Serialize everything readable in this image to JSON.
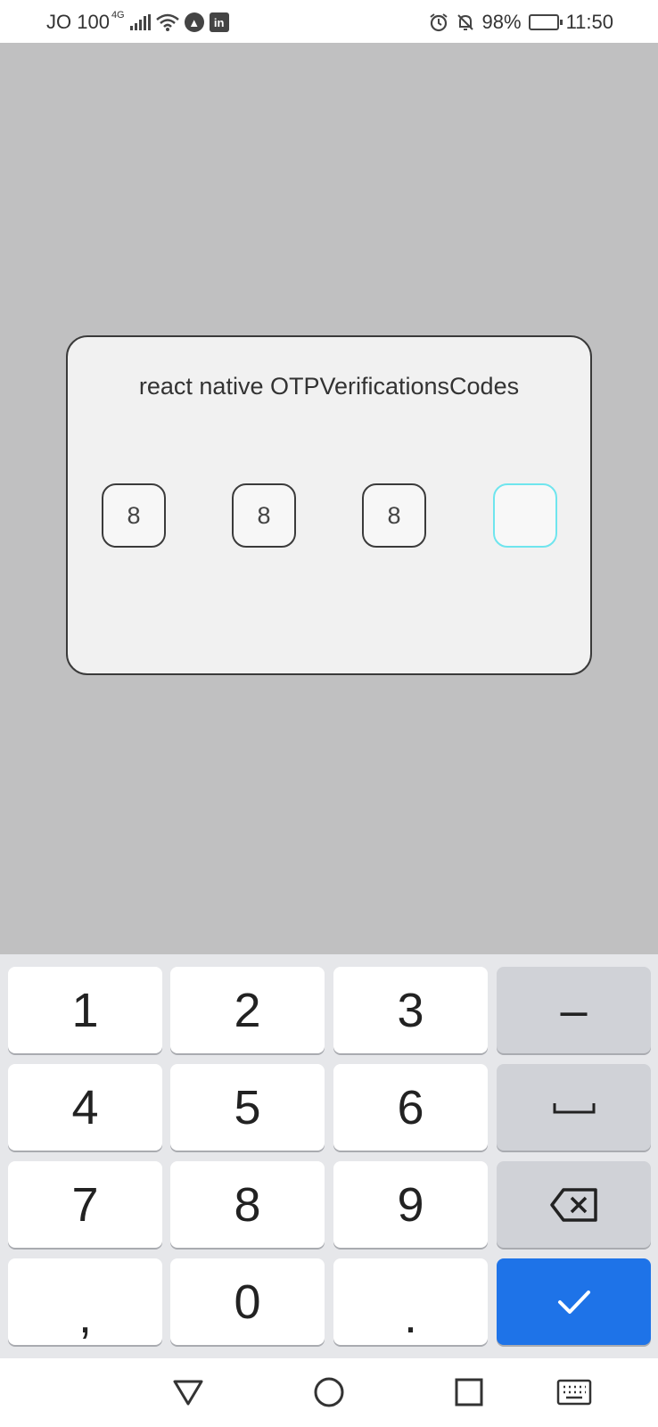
{
  "status_bar": {
    "carrier": "JO 100",
    "network": "4G",
    "battery": "98%",
    "time": "11:50",
    "icons": [
      "signal-icon",
      "wifi-icon",
      "app-icon",
      "linkedin-icon",
      "alarm-icon",
      "mute-icon",
      "battery-icon"
    ],
    "linkedin_label": "in"
  },
  "dialog": {
    "title": "react native OTPVerificationsCodes",
    "otp_digits": [
      "8",
      "8",
      "8",
      ""
    ],
    "focus_color": "#6fe5ee"
  },
  "keyboard": {
    "keys": {
      "k1": "1",
      "k2": "2",
      "k3": "3",
      "k4": "4",
      "k5": "5",
      "k6": "6",
      "k7": "7",
      "k8": "8",
      "k9": "9",
      "comma": ",",
      "k0": "0",
      "period": ".",
      "minus": "–"
    },
    "enter_color": "#1e73e8"
  },
  "nav_bar": {
    "buttons": [
      "back-icon",
      "home-icon",
      "recents-icon",
      "keyboard-switch-icon"
    ]
  }
}
